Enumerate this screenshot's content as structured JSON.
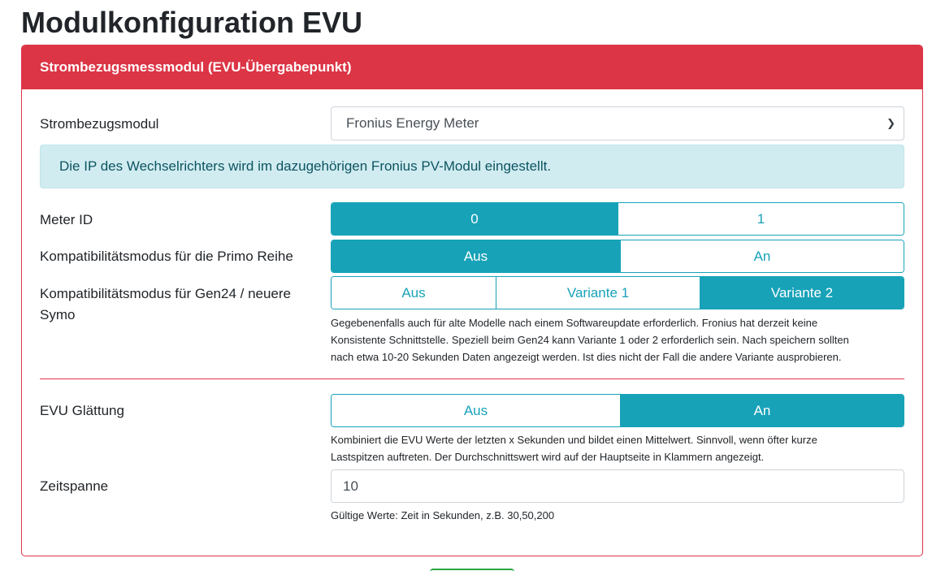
{
  "page": {
    "title": "Modulkonfiguration EVU"
  },
  "card": {
    "header": "Strombezugsmessmodul (EVU-Übergabepunkt)"
  },
  "module": {
    "label": "Strombezugsmodul",
    "selected": "Fronius Energy Meter"
  },
  "alert": {
    "text": "Die IP des Wechselrichters wird im dazugehörigen Fronius PV-Modul eingestellt."
  },
  "meter_id": {
    "label": "Meter ID",
    "options": [
      "0",
      "1"
    ],
    "selected": "0"
  },
  "primo": {
    "label": "Kompatibilitätsmodus für die Primo Reihe",
    "options": [
      "Aus",
      "An"
    ],
    "selected": "Aus"
  },
  "gen24": {
    "label_line1": "Kompatibilitätsmodus für Gen24 / neuere",
    "label_line2": "Symo",
    "options": [
      "Aus",
      "Variante 1",
      "Variante 2"
    ],
    "selected": "Variante 2",
    "help_line1": "Gegebenenfalls auch für alte Modelle nach einem Softwareupdate erforderlich. Fronius hat derzeit keine",
    "help_line2": "Konsistente Schnittstelle. Speziell beim Gen24 kann Variante 1 oder 2 erforderlich sein. Nach speichern sollten",
    "help_line3": "nach etwa 10-20 Sekunden Daten angezeigt werden. Ist dies nicht der Fall die andere Variante ausprobieren."
  },
  "smoothing": {
    "label": "EVU Glättung",
    "options": [
      "Aus",
      "An"
    ],
    "selected": "An",
    "help_line1": "Kombiniert die EVU Werte der letzten x Sekunden und bildet einen Mittelwert. Sinnvoll, wenn öfter kurze",
    "help_line2": "Lastspitzen auftreten. Der Durchschnittswert wird auf der Hauptseite in Klammern angezeigt."
  },
  "timespan": {
    "label": "Zeitspanne",
    "value": "10",
    "help": "Gültige Werte: Zeit in Sekunden, z.B. 30,50,200"
  },
  "colors": {
    "danger": "#dc3545",
    "info": "#17a2b8",
    "alert_bg": "#d1ecf1",
    "alert_text": "#0c5460"
  }
}
